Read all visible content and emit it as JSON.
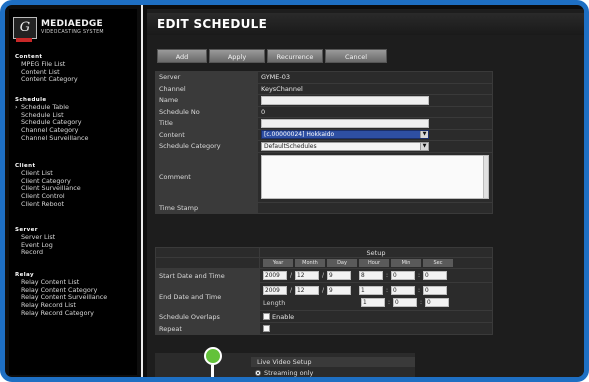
{
  "brand": {
    "name": "MEDIAEDGE",
    "sub": "VIDEOCASTING SYSTEM",
    "mark": "G"
  },
  "sidebar": {
    "sections": [
      {
        "title": "Content",
        "items": [
          "MPEG File List",
          "Content List",
          "Content Category"
        ]
      },
      {
        "title": "Schedule",
        "items": [
          "Schedule Table",
          "Schedule List",
          "Schedule Category",
          "Channel Category",
          "Channel Surveillance"
        ]
      },
      {
        "title": "Client",
        "items": [
          "Client List",
          "Client Category",
          "Client Surveillance",
          "Client Control",
          "Client Reboot"
        ]
      },
      {
        "title": "Server",
        "items": [
          "Server List",
          "Event Log",
          "Record"
        ]
      },
      {
        "title": "Relay",
        "items": [
          "Relay Content List",
          "Relay Content Category",
          "Relay Content Surveillance",
          "Relay Record List",
          "Relay Record Category"
        ]
      }
    ],
    "active": "Schedule Table"
  },
  "page": {
    "title": "EDIT SCHEDULE"
  },
  "toolbar": {
    "add": "Add",
    "apply": "Apply",
    "recurrence": "Recurrence",
    "cancel": "Cancel"
  },
  "form": {
    "server_label": "Server",
    "server_value": "GYME-03",
    "channel_label": "Channel",
    "channel_value": "KeysChannel",
    "name_label": "Name",
    "name_value": "",
    "schedule_no_label": "Schedule No",
    "schedule_no_value": "0",
    "title_label": "Title",
    "title_value": "",
    "content_label": "Content",
    "content_value": "[c.00000024] Hokkaido",
    "category_label": "Schedule Category",
    "category_value": "DefaultSchedules",
    "comment_label": "Comment",
    "comment_value": "",
    "timestamp_label": "Time Stamp",
    "timestamp_value": ""
  },
  "setup": {
    "title": "Setup",
    "units": [
      "Year",
      "Month",
      "Day",
      "Hour",
      "Min",
      "Sec"
    ],
    "start_label": "Start Date and Time",
    "start": [
      "2009",
      "12",
      "9",
      "8",
      "0",
      "0"
    ],
    "end_label": "End Date and Time",
    "end": [
      "2009",
      "12",
      "9",
      "1",
      "0",
      "0"
    ],
    "length_label": "Length",
    "length": [
      "1",
      "0",
      "0"
    ],
    "overlaps_label": "Schedule Overlaps",
    "overlaps_option": "Enable",
    "repeat_label": "Repeat"
  },
  "live": {
    "title": "Live Video Setup",
    "option": "Streaming only"
  },
  "colors": {
    "frame": "#1e6fc3",
    "marker": "#63c23a",
    "highlight": "#2e4fa3"
  }
}
